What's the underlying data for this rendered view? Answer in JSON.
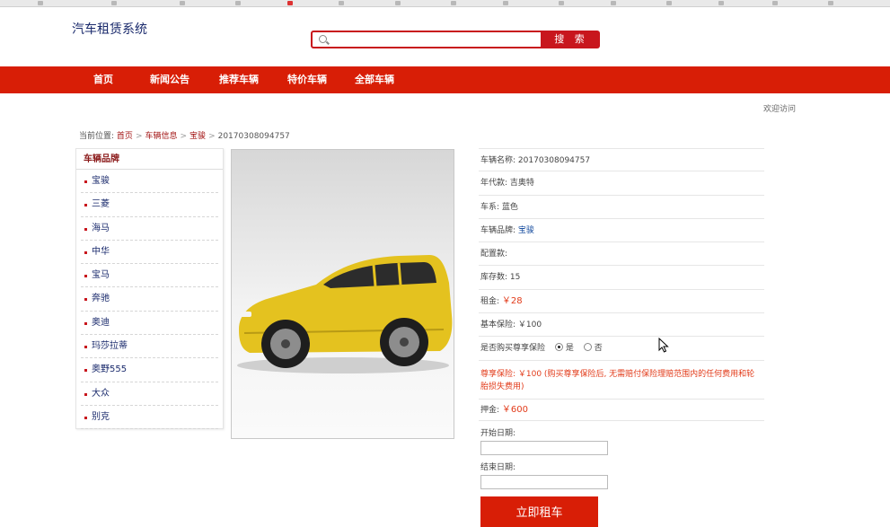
{
  "site": {
    "title": "汽车租赁系统"
  },
  "search": {
    "placeholder": "",
    "button_label": "搜 索"
  },
  "nav": [
    "首页",
    "新闻公告",
    "推荐车辆",
    "特价车辆",
    "全部车辆"
  ],
  "welcome": "欢迎访问",
  "breadcrumb": {
    "prefix": "当前位置:",
    "items": [
      "首页",
      "车辆信息",
      "宝骏"
    ],
    "current": "20170308094757"
  },
  "sidebar": {
    "title": "车辆品牌",
    "items": [
      "宝骏",
      "三菱",
      "海马",
      "中华",
      "宝马",
      "奔驰",
      "奥迪",
      "玛莎拉蒂",
      "奥野555",
      "大众",
      "别克"
    ]
  },
  "details": {
    "rows": [
      {
        "label": "车辆名称:",
        "value": "20170308094757"
      },
      {
        "label": "年代款:",
        "value": "吉奥特"
      },
      {
        "label": "车系:",
        "value": "蓝色"
      },
      {
        "label": "车辆品牌:",
        "value": "宝骏"
      },
      {
        "label": "配置款:",
        "value": ""
      },
      {
        "label": "库存数:",
        "value": "15"
      },
      {
        "label": "租金:",
        "value": "￥28"
      },
      {
        "label": "基本保险:",
        "value": "￥100"
      }
    ],
    "insurance_question": "是否购买尊享保险",
    "yes_label": "是",
    "no_label": "否",
    "notice": "尊享保险: ￥100 (购买尊享保险后, 无需赔付保险理赔范围内的任何费用和轮胎损失费用)",
    "deposit_label": "押金:",
    "deposit_value": "￥600",
    "start_date_label": "开始日期:",
    "end_date_label": "结束日期:",
    "rent_button": "立即租车"
  },
  "colors": {
    "brand_red": "#d81e06",
    "link_dark": "#1a2a6c",
    "price": "#e23b1a"
  },
  "icons": {
    "search": "search-icon",
    "cursor": "cursor-icon"
  }
}
